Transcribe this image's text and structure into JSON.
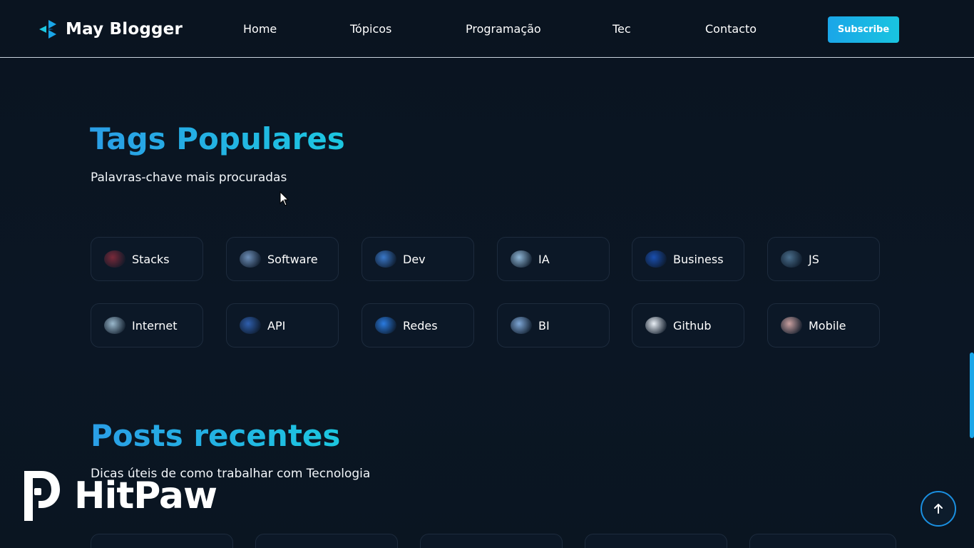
{
  "header": {
    "brand": "May Blogger",
    "nav": [
      "Home",
      "Tópicos",
      "Programação",
      "Tec",
      "Contacto"
    ],
    "subscribe_label": "Subscribe"
  },
  "tags_section": {
    "title": "Tags Populares",
    "subtitle": "Palavras-chave mais procuradas",
    "tags": [
      {
        "label": "Stacks",
        "icon": "stacks-thumb-icon",
        "color": "#7a2a3a"
      },
      {
        "label": "Software",
        "icon": "software-thumb-icon",
        "color": "#6e8fb8"
      },
      {
        "label": "Dev",
        "icon": "dev-thumb-icon",
        "color": "#3a78c9"
      },
      {
        "label": "IA",
        "icon": "ia-thumb-icon",
        "color": "#8fb6d6"
      },
      {
        "label": "Business",
        "icon": "business-thumb-icon",
        "color": "#1a4fb0"
      },
      {
        "label": "JS",
        "icon": "js-thumb-icon",
        "color": "#4a6e8c"
      },
      {
        "label": "Internet",
        "icon": "internet-thumb-icon",
        "color": "#9ab8cc"
      },
      {
        "label": "API",
        "icon": "api-thumb-icon",
        "color": "#2f5fae"
      },
      {
        "label": "Redes",
        "icon": "redes-thumb-icon",
        "color": "#2a7be0"
      },
      {
        "label": "BI",
        "icon": "bi-thumb-icon",
        "color": "#7ea7d6"
      },
      {
        "label": "Github",
        "icon": "github-icon",
        "color": "#e8eef5"
      },
      {
        "label": "Mobile",
        "icon": "mobile-thumb-icon",
        "color": "#c9a0a0"
      }
    ]
  },
  "posts_section": {
    "title": "Posts recentes",
    "subtitle": "Dicas úteis de como trabalhar com Tecnologia"
  },
  "watermark": {
    "text": "HitPaw"
  },
  "colors": {
    "background": "#0b1522",
    "accent": "#1aa6e8",
    "accent_alt": "#1cc7e0"
  }
}
